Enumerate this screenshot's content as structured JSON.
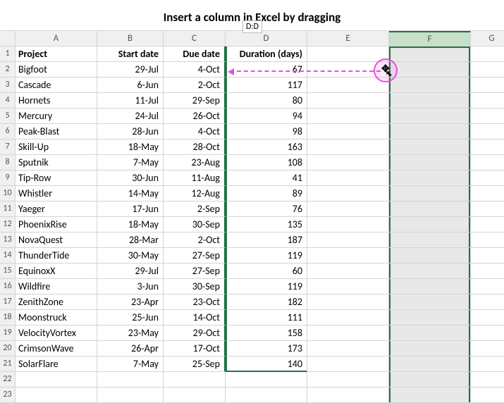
{
  "title": "Insert a column in Excel by dragging",
  "tooltip": "D:D",
  "columns": [
    "",
    "A",
    "B",
    "C",
    "D",
    "E",
    "F",
    "G"
  ],
  "headers": {
    "A": "Project",
    "B": "Start date",
    "C": "Due date",
    "D": "Duration (days)"
  },
  "chart_data": {
    "type": "table",
    "columns": [
      "Project",
      "Start date",
      "Due date",
      "Duration (days)"
    ],
    "rows": [
      [
        "Bigfoot",
        "29-Jul",
        "4-Oct",
        67
      ],
      [
        "Cascade",
        "6-Jun",
        "2-Oct",
        117
      ],
      [
        "Hornets",
        "11-Jul",
        "29-Sep",
        80
      ],
      [
        "Mercury",
        "24-Jul",
        "26-Oct",
        94
      ],
      [
        "Peak-Blast",
        "28-Jun",
        "4-Oct",
        98
      ],
      [
        "Skill-Up",
        "18-May",
        "28-Oct",
        163
      ],
      [
        "Sputnik",
        "7-May",
        "23-Aug",
        108
      ],
      [
        "Tip-Row",
        "30-Jun",
        "11-Aug",
        41
      ],
      [
        "Whistler",
        "14-May",
        "12-Aug",
        89
      ],
      [
        "Yaeger",
        "17-Jun",
        "2-Sep",
        76
      ],
      [
        "PhoenixRise",
        "18-May",
        "30-Sep",
        135
      ],
      [
        "NovaQuest",
        "28-Mar",
        "2-Oct",
        187
      ],
      [
        "ThunderTide",
        "30-May",
        "27-Sep",
        119
      ],
      [
        "EquinoxX",
        "29-Jul",
        "27-Sep",
        60
      ],
      [
        "Wildfire",
        "3-Jun",
        "30-Sep",
        119
      ],
      [
        "ZenithZone",
        "23-Apr",
        "23-Oct",
        182
      ],
      [
        "Moonstruck",
        "25-Jun",
        "14-Oct",
        111
      ],
      [
        "VelocityVortex",
        "23-May",
        "29-Oct",
        158
      ],
      [
        "CrimsonWave",
        "26-Apr",
        "17-Oct",
        173
      ],
      [
        "SolarFlare",
        "7-May",
        "25-Sep",
        140
      ]
    ]
  },
  "extra_rows": [
    22,
    23
  ],
  "selected_column": "F",
  "insert_target_column": "D"
}
